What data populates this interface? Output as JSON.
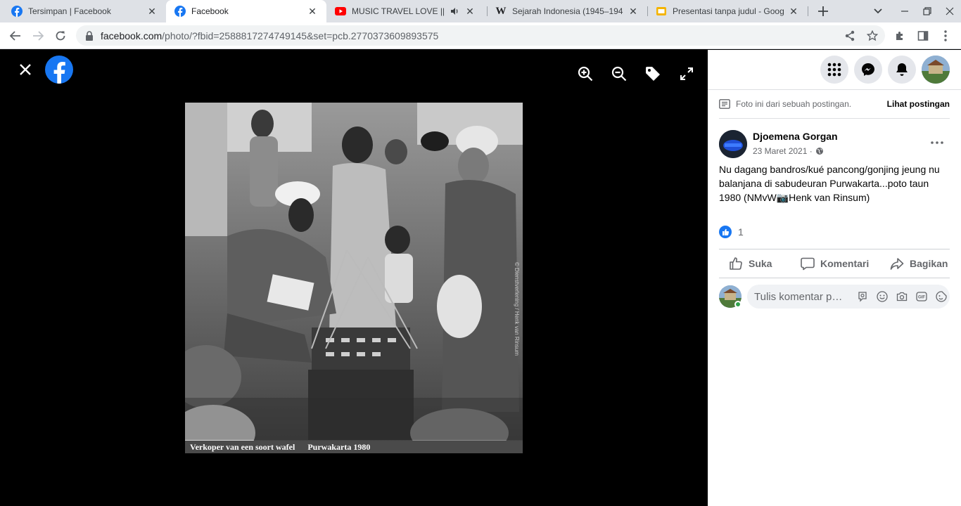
{
  "browser": {
    "tabs": [
      {
        "title": "Tersimpan | Facebook",
        "favicon": "facebook-icon",
        "active": false
      },
      {
        "title": "Facebook",
        "favicon": "facebook-icon",
        "active": true
      },
      {
        "title": "MUSIC TRAVEL LOVE || #m",
        "favicon": "youtube-icon",
        "active": false,
        "audio": true
      },
      {
        "title": "Sejarah Indonesia (1945–194",
        "favicon": "wikipedia-icon",
        "active": false
      },
      {
        "title": "Presentasi tanpa judul - Goog",
        "favicon": "google-slides-icon",
        "active": false
      }
    ],
    "url_host": "facebook.com",
    "url_path": "/photo/?fbid=2588817274749145&set=pcb.2770373609893575"
  },
  "viewer": {
    "caption_left": "Verkoper van een soort wafel",
    "caption_right": "Purwakarta 1980",
    "credit": "© Dienstverlening / Henk van Rinsum"
  },
  "panel": {
    "notice_text": "Foto ini dari sebuah postingan.",
    "notice_link": "Lihat postingan",
    "author_name": "Djoemena Gorgan",
    "post_date": "23 Maret 2021 ·",
    "post_text": "Nu dagang bandros/kué pancong/gonjing jeung nu balanjana di sabudeuran Purwakarta...poto taun 1980 (NMvW📷Henk van Rinsum)",
    "reaction_count": "1",
    "actions": {
      "like": "Suka",
      "comment": "Komentari",
      "share": "Bagikan"
    },
    "comment_placeholder": "Tulis komentar publik..."
  },
  "colors": {
    "facebook_blue": "#1877f2",
    "chrome_tabstrip": "#dee1e6",
    "secondary_text": "#65676b"
  }
}
